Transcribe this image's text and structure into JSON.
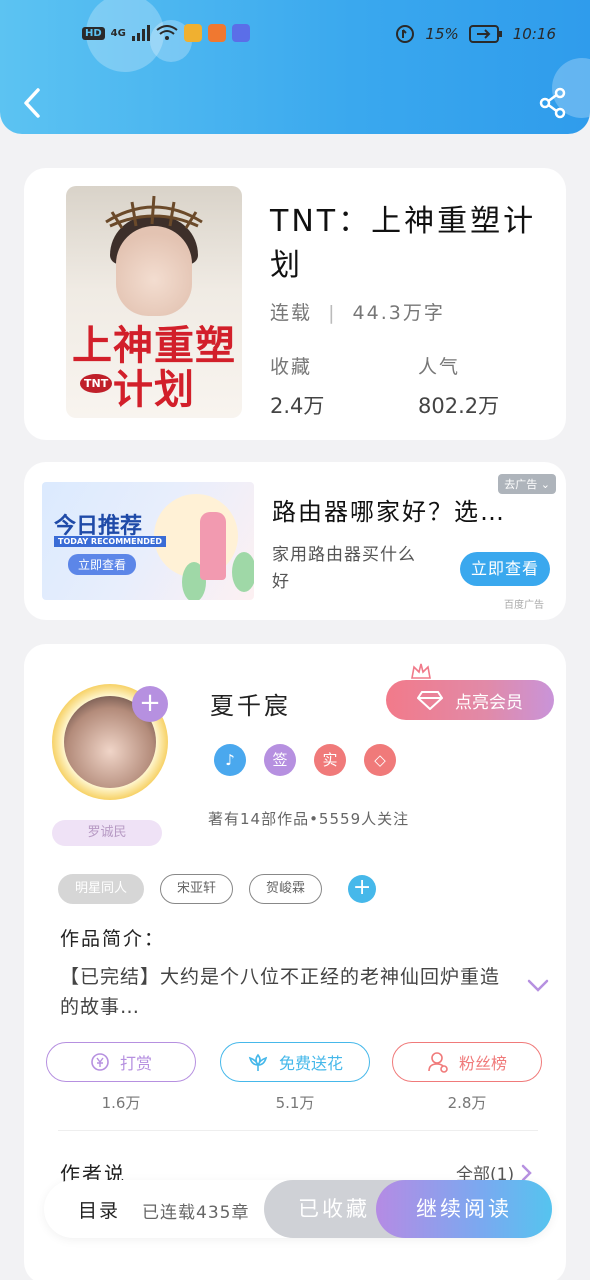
{
  "status_bar": {
    "network_badge": "HD",
    "network_type": "4G",
    "battery": "15%",
    "time": "10:16"
  },
  "book": {
    "title": "TNT：上神重塑计划",
    "status": "连载",
    "word_count": "44.3万字",
    "favorites_label": "收藏",
    "favorites_value": "2.4万",
    "popularity_label": "人气",
    "popularity_value": "802.2万",
    "cover_title": "上神重塑计划",
    "cover_badge": "TNT"
  },
  "ad": {
    "close_label": "去广告",
    "title": "路由器哪家好？选…",
    "description": "家用路由器买什么好",
    "button": "立即查看",
    "source": "百度广告",
    "image_text_main": "今日推荐",
    "image_text_sub": "TODAY RECOMMENDED",
    "image_text_btn": "立即查看"
  },
  "author": {
    "name": "夏千宸",
    "vip_button": "点亮会员",
    "badges": [
      "♪",
      "签",
      "实",
      "◇"
    ],
    "badge_colors": [
      "#4aa8ee",
      "#b690e0",
      "#f07a7a",
      "#f07a7a"
    ],
    "stats": "著有14部作品•5559人关注",
    "fan_badge": "罗诚民"
  },
  "tags": [
    "明星同人",
    "宋亚轩",
    "贺峻霖"
  ],
  "intro": {
    "label": "作品简介：",
    "text": "【已完结】大约是个八位不正经的老神仙回炉重造的故事…"
  },
  "actions": [
    {
      "label": "打赏",
      "count": "1.6万",
      "color": "#b690e0"
    },
    {
      "label": "免费送花",
      "count": "5.1万",
      "color": "#46b8ea"
    },
    {
      "label": "粉丝榜",
      "count": "2.8万",
      "color": "#f07a7a"
    }
  ],
  "author_says": {
    "label": "作者说",
    "all_link": "全部(1)"
  },
  "bottom_bar": {
    "toc": "目录",
    "toc_sub": "已连载435章",
    "fav_button": "已收藏",
    "read_button": "继续阅读"
  }
}
